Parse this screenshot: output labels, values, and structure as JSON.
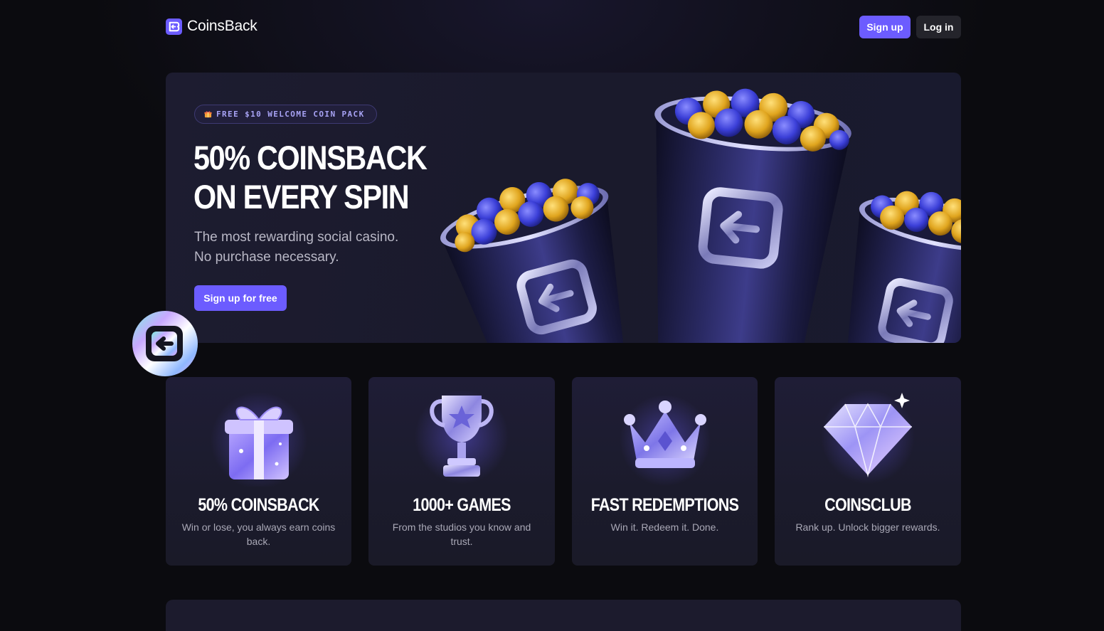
{
  "brand": {
    "name": "CoinsBack",
    "accent": "#6c5cff"
  },
  "header": {
    "signup_label": "Sign up",
    "login_label": "Log in"
  },
  "hero": {
    "promo_icon": "gift-icon",
    "promo_text": "FREE $10 WELCOME COIN PACK",
    "title_line1": "50% COINSBACK",
    "title_line2": "ON EVERY SPIN",
    "subtitle_line1": "The most rewarding social casino.",
    "subtitle_line2": "No purchase necessary.",
    "cta_label": "Sign up for free",
    "art": "coin-cups-illustration"
  },
  "features": [
    {
      "icon": "gift-box-icon",
      "title": "50% COINSBACK",
      "description": "Win or lose, you always earn coins back."
    },
    {
      "icon": "trophy-icon",
      "title": "1000+ GAMES",
      "description": "From the studios you know and trust."
    },
    {
      "icon": "crown-icon",
      "title": "FAST REDEMPTIONS",
      "description": "Win it. Redeem it. Done."
    },
    {
      "icon": "diamond-icon",
      "title": "COINSCLUB",
      "description": "Rank up. Unlock bigger rewards."
    }
  ]
}
